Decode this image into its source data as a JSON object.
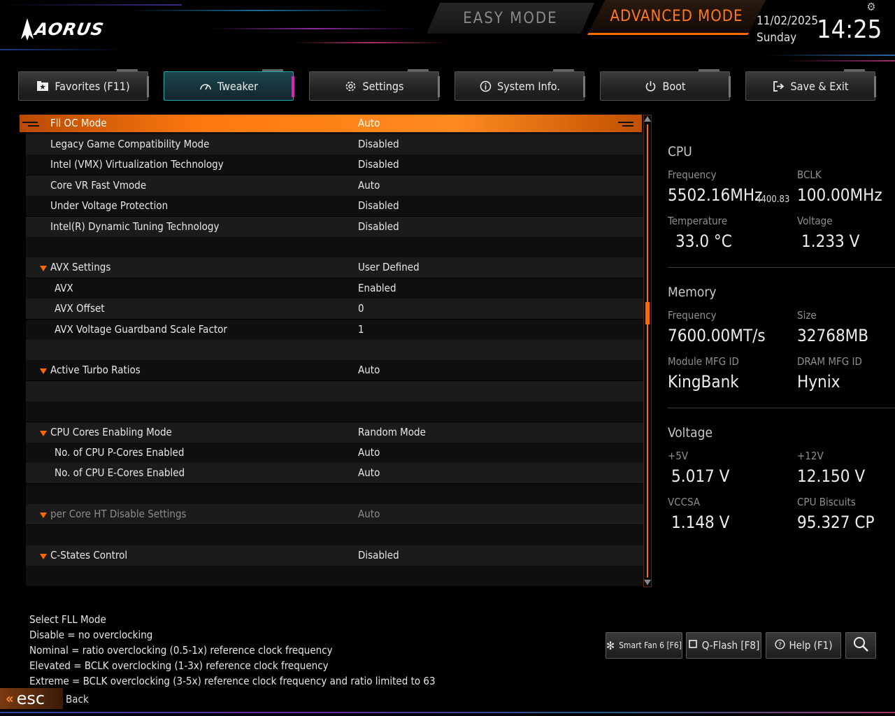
{
  "brand": {
    "logo_text": "AORUS"
  },
  "modes": {
    "easy": "EASY MODE",
    "advanced": "ADVANCED MODE"
  },
  "clock": {
    "date": "11/02/2025",
    "day": "Sunday",
    "time": "14:25"
  },
  "colors": {
    "accent": "#ff6a00",
    "active_tab": "#1c4650",
    "active_tab_edge": "#e020c0"
  },
  "tabs": [
    {
      "label": "Favorites (F11)",
      "icon": "star-folder-icon"
    },
    {
      "label": "Tweaker",
      "icon": "gauge-icon",
      "active": true
    },
    {
      "label": "Settings",
      "icon": "gear-icon"
    },
    {
      "label": "System Info.",
      "icon": "info-icon"
    },
    {
      "label": "Boot",
      "icon": "power-icon"
    },
    {
      "label": "Save & Exit",
      "icon": "exit-icon"
    }
  ],
  "settings": {
    "selected": {
      "label": "Fll OC Mode",
      "value": "Auto"
    },
    "rows": [
      {
        "label": "Legacy Game Compatibility Mode",
        "value": "Disabled"
      },
      {
        "label": "Intel (VMX) Virtualization Technology",
        "value": "Disabled"
      },
      {
        "label": "Core VR Fast Vmode",
        "value": "Auto"
      },
      {
        "label": "Under Voltage Protection",
        "value": "Disabled"
      },
      {
        "label": "Intel(R) Dynamic Tuning Technology",
        "value": "Disabled"
      },
      {
        "label": "",
        "value": ""
      },
      {
        "label": "AVX Settings",
        "value": "User Defined",
        "expandable": true
      },
      {
        "label": "AVX",
        "value": "Enabled",
        "indent": 1
      },
      {
        "label": "AVX Offset",
        "value": "0",
        "indent": 1
      },
      {
        "label": "AVX Voltage Guardband Scale Factor",
        "value": "1",
        "indent": 1
      },
      {
        "label": "",
        "value": ""
      },
      {
        "label": "Active Turbo Ratios",
        "value": "Auto",
        "expandable": true
      },
      {
        "label": "",
        "value": ""
      },
      {
        "label": "",
        "value": ""
      },
      {
        "label": "CPU Cores Enabling Mode",
        "value": "Random Mode",
        "expandable": true
      },
      {
        "label": "No. of CPU P-Cores Enabled",
        "value": "Auto",
        "indent": 1
      },
      {
        "label": "No. of CPU E-Cores Enabled",
        "value": "Auto",
        "indent": 1
      },
      {
        "label": "",
        "value": ""
      },
      {
        "label": "per Core HT Disable Settings",
        "value": "Auto",
        "expandable": true,
        "disabled": true
      },
      {
        "label": "",
        "value": ""
      },
      {
        "label": "C-States Control",
        "value": "Disabled",
        "expandable": true
      },
      {
        "label": "",
        "value": ""
      }
    ]
  },
  "monitor": {
    "cpu": {
      "title": "CPU",
      "frequency_label": "Frequency",
      "frequency": "5502.16MHz",
      "frequency_sub": "4400.83",
      "bclk_label": "BCLK",
      "bclk": "100.00MHz",
      "temperature_label": "Temperature",
      "temperature": "33.0 °C",
      "voltage_label": "Voltage",
      "voltage": "1.233 V"
    },
    "memory": {
      "title": "Memory",
      "frequency_label": "Frequency",
      "frequency": "7600.00MT/s",
      "size_label": "Size",
      "size": "32768MB",
      "module_label": "Module MFG ID",
      "module": "KingBank",
      "dram_label": "DRAM MFG ID",
      "dram": "Hynix"
    },
    "voltage": {
      "title": "Voltage",
      "v5_label": "+5V",
      "v5": "5.017 V",
      "v12_label": "+12V",
      "v12": "12.150 V",
      "vccsa_label": "VCCSA",
      "vccsa": "1.148 V",
      "biscuits_label": "CPU Biscuits",
      "biscuits": "95.327 CP"
    }
  },
  "help": [
    "Select FLL Mode",
    "Disable = no overclocking",
    "Nominal = ratio overclocking (0.5-1x) reference clock frequency",
    "Elevated = BCLK overclocking (1-3x) reference clock frequency",
    "Extreme = BCLK overclocking (3-5x) reference clock frequency and ratio limited to 63"
  ],
  "bottom_buttons": {
    "smart_fan": "Smart Fan 6 [F6]",
    "qflash": "Q-Flash [F8]",
    "help": "Help (F1)"
  },
  "esc": {
    "key": "esc",
    "label": "Back"
  }
}
